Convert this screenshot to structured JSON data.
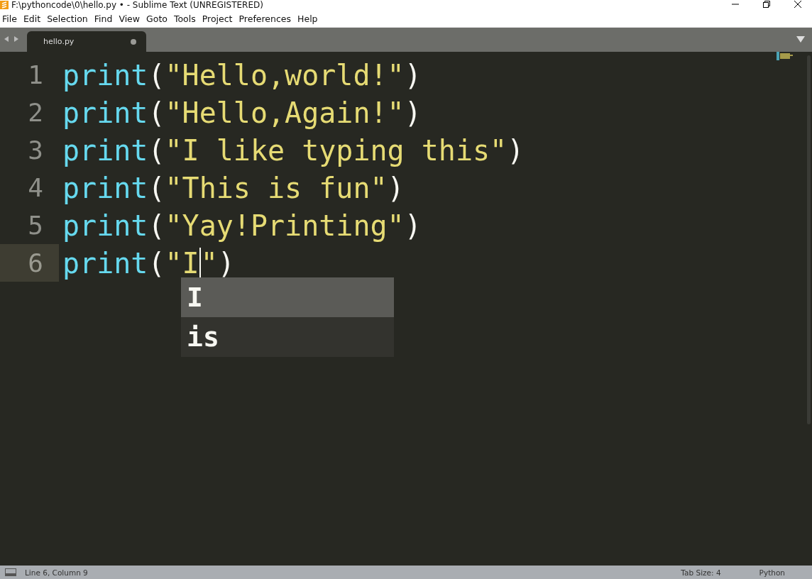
{
  "window": {
    "title": "F:\\pythoncode\\0\\hello.py • - Sublime Text (UNREGISTERED)"
  },
  "menu": [
    "File",
    "Edit",
    "Selection",
    "Find",
    "View",
    "Goto",
    "Tools",
    "Project",
    "Preferences",
    "Help"
  ],
  "tabs": [
    {
      "label": "hello.py",
      "selected": true,
      "modified": true
    }
  ],
  "editor": {
    "lines": [
      {
        "number": "1",
        "current": false,
        "tokens": [
          {
            "kind": "function",
            "text": "print"
          },
          {
            "kind": "punctuation",
            "text": "("
          },
          {
            "kind": "string",
            "text": "\"Hello,world!\""
          },
          {
            "kind": "punctuation",
            "text": ")"
          }
        ]
      },
      {
        "number": "2",
        "current": false,
        "tokens": [
          {
            "kind": "function",
            "text": "print"
          },
          {
            "kind": "punctuation",
            "text": "("
          },
          {
            "kind": "string",
            "text": "\"Hello,Again!\""
          },
          {
            "kind": "punctuation",
            "text": ")"
          }
        ]
      },
      {
        "number": "3",
        "current": false,
        "tokens": [
          {
            "kind": "function",
            "text": "print"
          },
          {
            "kind": "punctuation",
            "text": "("
          },
          {
            "kind": "string",
            "text": "\"I like typing this\""
          },
          {
            "kind": "punctuation",
            "text": ")"
          }
        ]
      },
      {
        "number": "4",
        "current": false,
        "tokens": [
          {
            "kind": "function",
            "text": "print"
          },
          {
            "kind": "punctuation",
            "text": "("
          },
          {
            "kind": "string",
            "text": "\"This is fun\""
          },
          {
            "kind": "punctuation",
            "text": ")"
          }
        ]
      },
      {
        "number": "5",
        "current": false,
        "tokens": [
          {
            "kind": "function",
            "text": "print"
          },
          {
            "kind": "punctuation",
            "text": "("
          },
          {
            "kind": "string",
            "text": "\"Yay!Printing\""
          },
          {
            "kind": "punctuation",
            "text": ")"
          }
        ]
      },
      {
        "number": "6",
        "current": true,
        "tokens": [
          {
            "kind": "function",
            "text": "print"
          },
          {
            "kind": "punctuation",
            "text": "("
          },
          {
            "kind": "string",
            "text": "\"I"
          },
          {
            "kind": "caret"
          },
          {
            "kind": "string",
            "text": "\""
          },
          {
            "kind": "punctuation",
            "text": ")"
          }
        ]
      }
    ],
    "autocomplete": [
      {
        "label": "I",
        "selected": true
      },
      {
        "label": "is",
        "selected": false
      }
    ]
  },
  "status_bar": {
    "position": "Line 6, Column 9",
    "tab_size": "Tab Size: 4",
    "syntax": "Python"
  }
}
